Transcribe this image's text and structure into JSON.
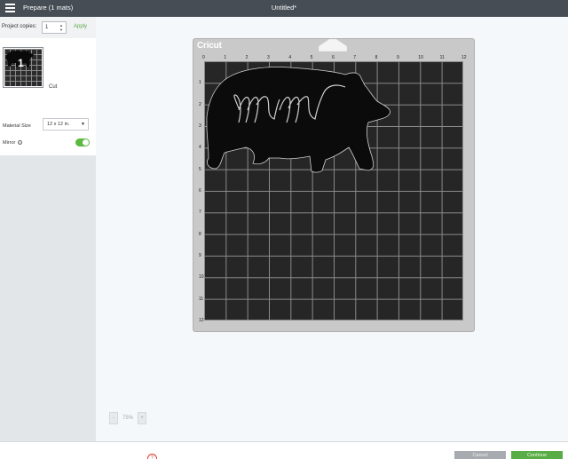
{
  "header": {
    "prepare_title": "Prepare (1 mats)",
    "document_title": "Untitled*"
  },
  "sidebar": {
    "copies_label": "Project copies:",
    "copies_value": "1",
    "apply_label": "Apply",
    "mat": {
      "number": "1",
      "label": "Cut"
    },
    "material_size_label": "Material Size",
    "material_size_value": "12 x 12 in.",
    "mirror_label": "Mirror",
    "mirror_on": true
  },
  "canvas": {
    "brand": "Cricut",
    "ruler_top": [
      "0",
      "1",
      "2",
      "3",
      "4",
      "5",
      "6",
      "7",
      "8",
      "9",
      "10",
      "11",
      "12"
    ],
    "ruler_left": [
      "1",
      "2",
      "3",
      "4",
      "5",
      "6",
      "7",
      "8",
      "9",
      "10",
      "11",
      "12"
    ],
    "design_text": "mama",
    "zoom_value": "75%",
    "zoom_minus": "-",
    "zoom_plus": "+"
  },
  "footer": {
    "cancel_label": "Cancel",
    "continue_label": "Continue"
  },
  "colors": {
    "topbar": "#464d55",
    "accent_green": "#5ab93e",
    "mat_black": "#262626",
    "mat_frame": "#c9c9c9"
  }
}
